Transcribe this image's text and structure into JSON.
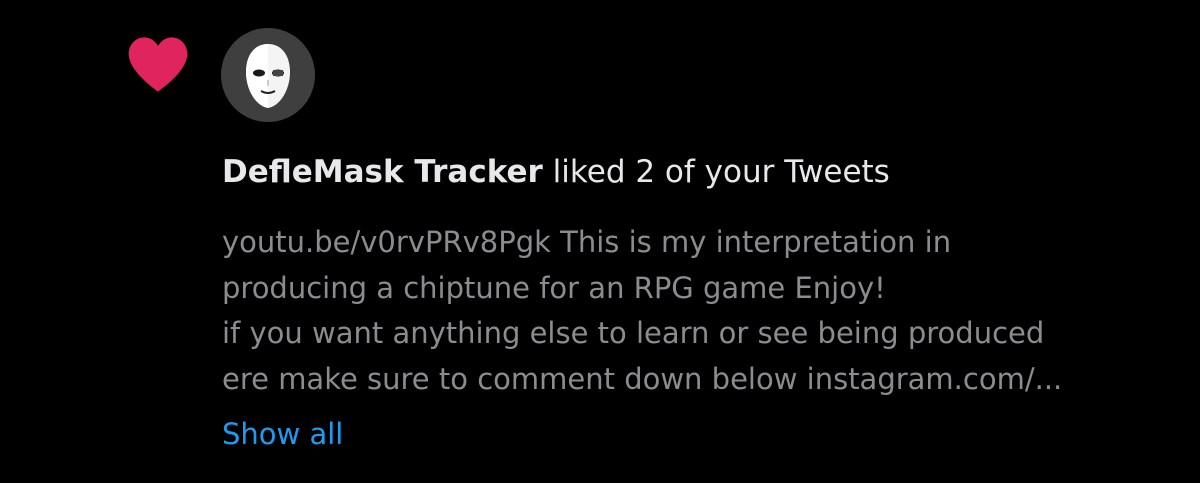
{
  "notification": {
    "type_icon": "heart-icon",
    "avatar_icon": "mask-avatar",
    "user_name": "DefleMask Tracker",
    "action_text": "liked 2 of your Tweets",
    "tweet_lines": [
      "youtu.be/v0rvPRv8Pgk This is my interpretation in",
      "producing a chiptune for an RPG game Enjoy!",
      "if you want anything else to learn or see being produced",
      "ere make sure to comment down below instagram.com/..."
    ],
    "show_all_label": "Show all"
  },
  "colors": {
    "background": "#000000",
    "heart": "#e0245e",
    "headline_text": "#e8e8ea",
    "body_text": "#8b8c90",
    "link": "#1d9bf0",
    "avatar_bg": "#3f3f3f"
  }
}
